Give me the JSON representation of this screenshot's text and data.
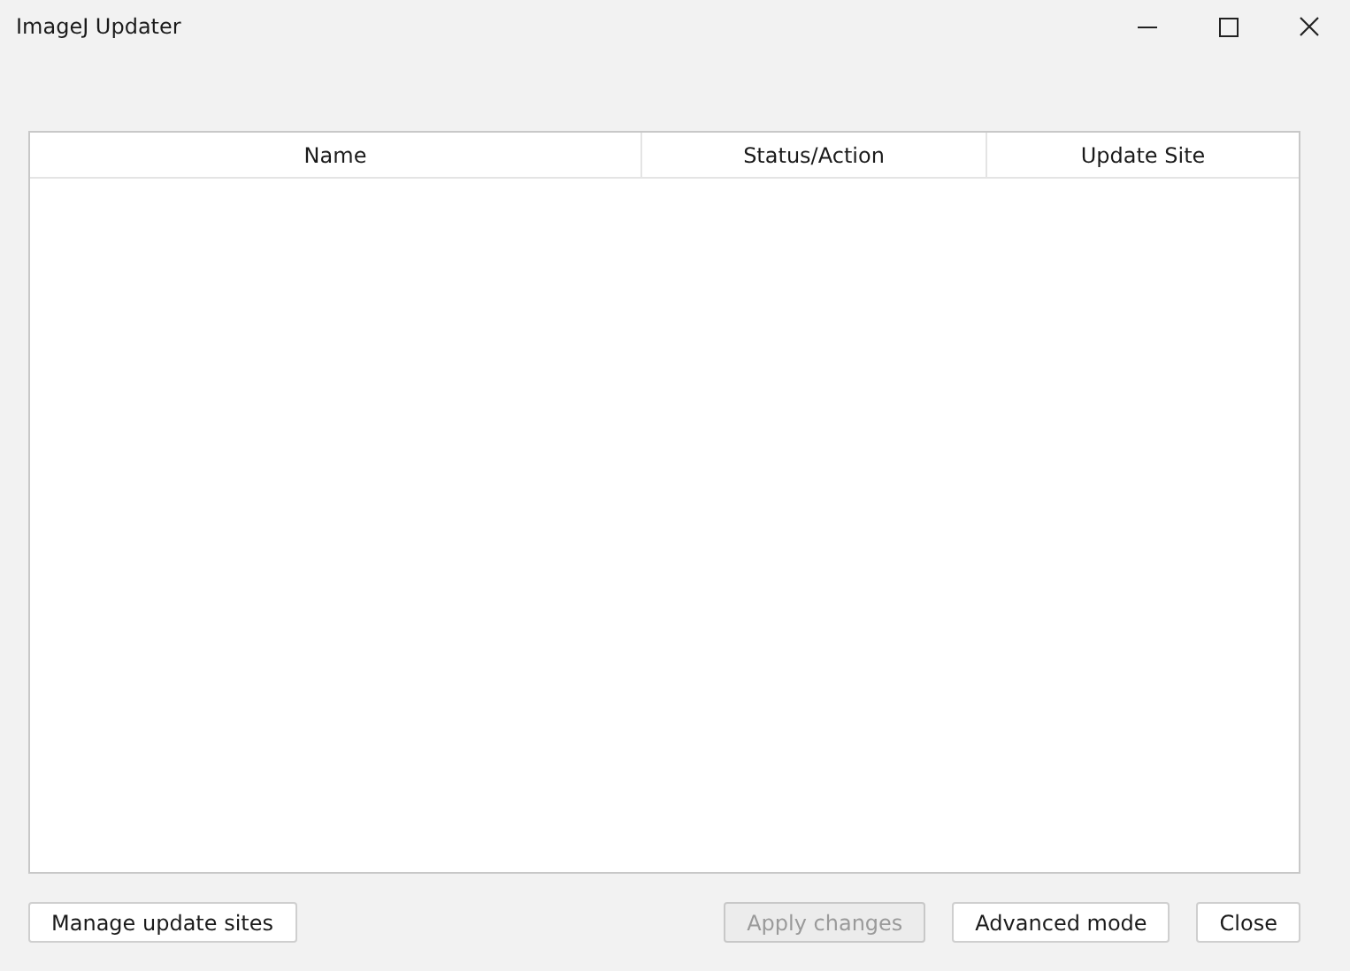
{
  "window": {
    "title": "ImageJ Updater"
  },
  "table": {
    "columns": [
      "Name",
      "Status/Action",
      "Update Site"
    ]
  },
  "left_buttons": [
    {
      "label": "Manage update sites",
      "disabled": false
    }
  ],
  "right_buttons": [
    {
      "label": "Apply changes",
      "disabled": true
    },
    {
      "label": "Advanced mode",
      "disabled": false
    },
    {
      "label": "Close",
      "disabled": false
    }
  ]
}
